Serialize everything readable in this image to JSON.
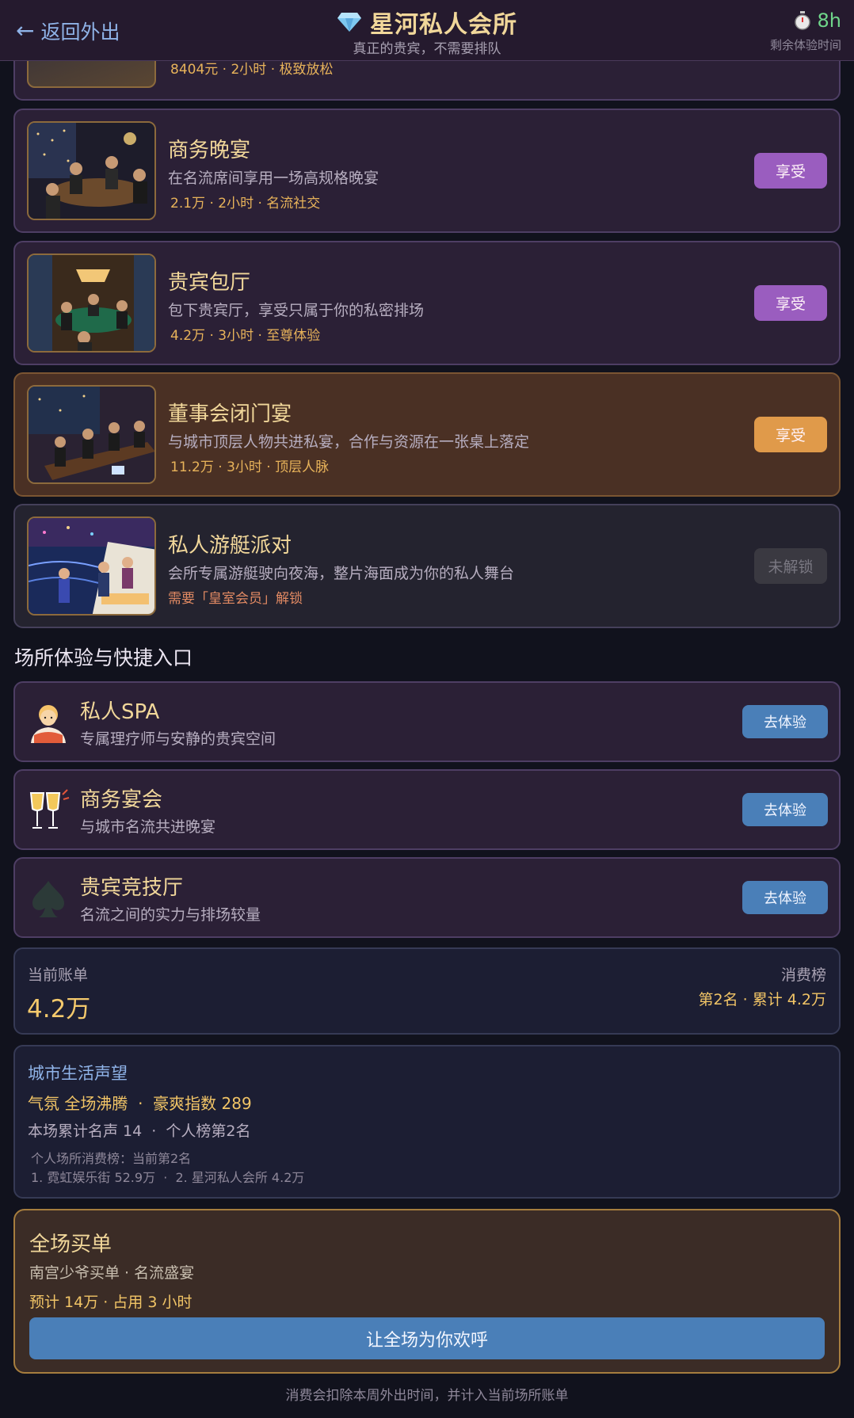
{
  "header": {
    "back_label": "返回外出",
    "title": "星河私人会所",
    "subtitle": "真正的贵宾，不需要排队",
    "timer_value": "8h",
    "timer_label": "剩余体验时间"
  },
  "experiences": [
    {
      "title": "",
      "desc": "",
      "meta": "8404元 · 2小时 · 极致放松",
      "button": ""
    },
    {
      "title": "商务晚宴",
      "desc": "在名流席间享用一场高规格晚宴",
      "meta": "2.1万 · 2小时 · 名流社交",
      "button": "享受"
    },
    {
      "title": "贵宾包厅",
      "desc": "包下贵宾厅，享受只属于你的私密排场",
      "meta": "4.2万 · 3小时 · 至尊体验",
      "button": "享受"
    },
    {
      "title": "董事会闭门宴",
      "desc": "与城市顶层人物共进私宴，合作与资源在一张桌上落定",
      "meta": "11.2万 · 3小时 · 顶层人脉",
      "button": "享受"
    },
    {
      "title": "私人游艇派对",
      "desc": "会所专属游艇驶向夜海，整片海面成为你的私人舞台",
      "meta": "需要「皇室会员」解锁",
      "button": "未解锁"
    }
  ],
  "section_title": "场所体验与快捷入口",
  "shortcuts": [
    {
      "title": "私人SPA",
      "desc": "专属理疗师与安静的贵宾空间",
      "button": "去体验",
      "icon": "spa-person-icon"
    },
    {
      "title": "商务宴会",
      "desc": "与城市名流共进晚宴",
      "button": "去体验",
      "icon": "champagne-icon"
    },
    {
      "title": "贵宾竞技厅",
      "desc": "名流之间的实力与排场较量",
      "button": "去体验",
      "icon": "spade-icon"
    }
  ],
  "bill": {
    "label": "当前账单",
    "amount": "4.2万",
    "rank_label": "消费榜",
    "rank_value": "第2名 · 累计 4.2万"
  },
  "prestige": {
    "title": "城市生活声望",
    "line1": "气氛 全场沸腾  ·  豪爽指数 289",
    "line2": "本场累计名声 14  ·  个人榜第2名",
    "line3": "个人场所消费榜：当前第2名",
    "line4": "1. 霓虹娱乐街 52.9万  ·  2. 星河私人会所 4.2万"
  },
  "treat": {
    "title": "全场买单",
    "subtitle": "南宫少爷买单 · 名流盛宴",
    "estimate": "预计 14万 · 占用 3 小时",
    "button": "让全场为你欢呼"
  },
  "footnote": "消费会扣除本周外出时间，并计入当前场所账单",
  "colors": {
    "accent_gold": "#f1d79a",
    "button_purple": "#9a5dbf",
    "button_orange": "#e09a4a",
    "button_blue": "#4a7fb8",
    "timer_green": "#6fd58a"
  }
}
